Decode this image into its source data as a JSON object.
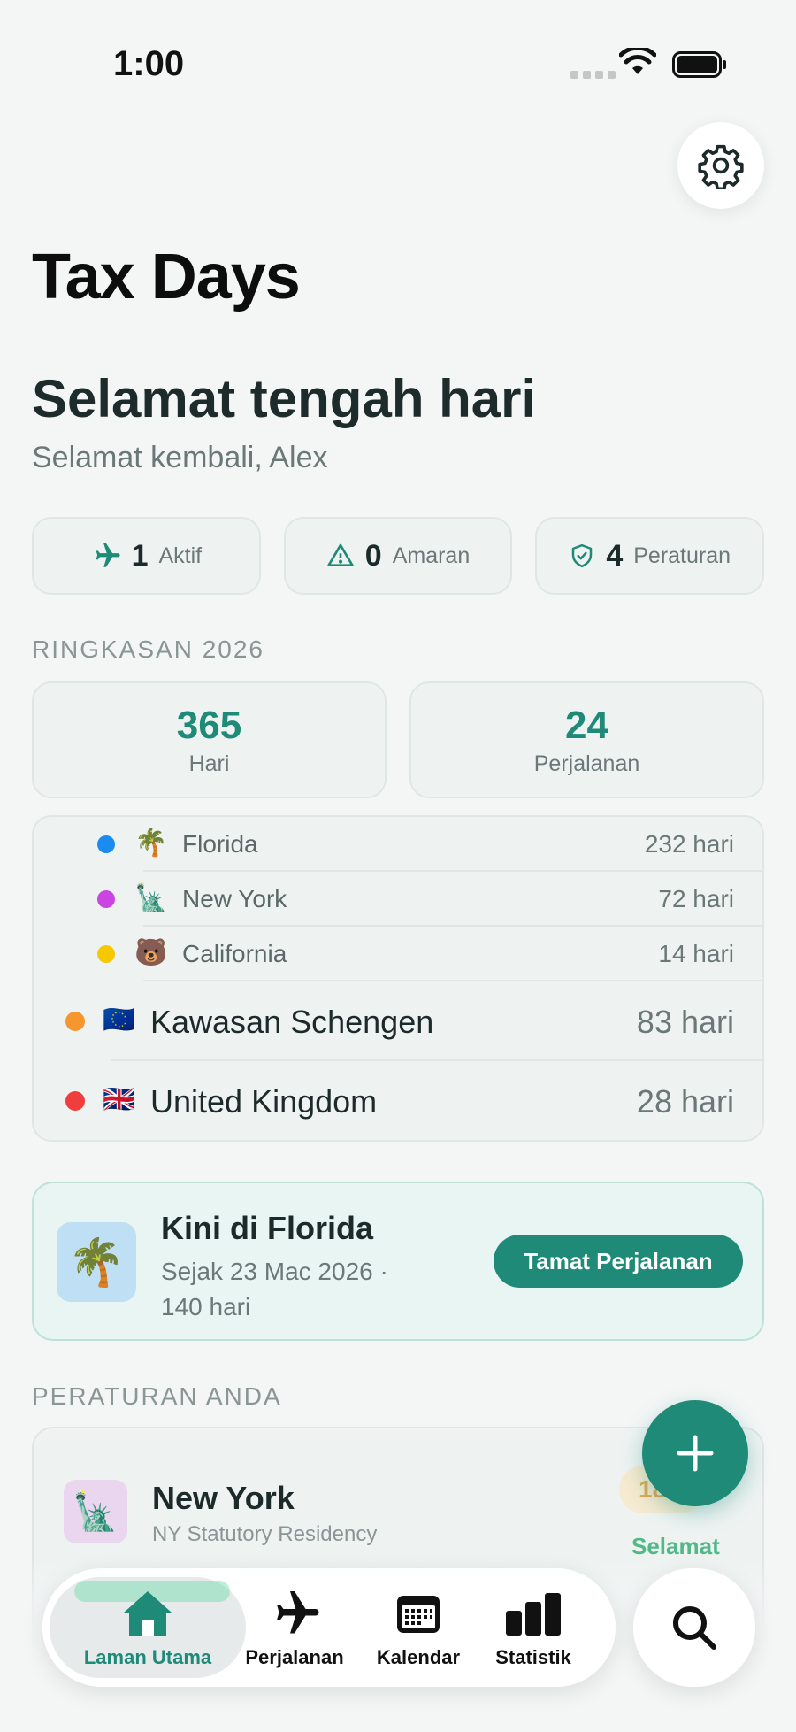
{
  "status": {
    "time": "1:00"
  },
  "header": {
    "title": "Tax Days",
    "greeting": "Selamat tengah hari",
    "welcome": "Selamat kembali, Alex"
  },
  "chips": [
    {
      "value": "1",
      "label": "Aktif",
      "icon": "airplane-icon"
    },
    {
      "value": "0",
      "label": "Amaran",
      "icon": "warning-icon"
    },
    {
      "value": "4",
      "label": "Peraturan",
      "icon": "shield-check-icon"
    }
  ],
  "summary": {
    "heading": "RINGKASAN 2026",
    "days": {
      "value": "365",
      "label": "Hari"
    },
    "trips": {
      "value": "24",
      "label": "Perjalanan"
    }
  },
  "regions": [
    {
      "flag": "🌴",
      "name": "Florida",
      "days": "232 hari",
      "color": "#1a8cf0",
      "level": "sub"
    },
    {
      "flag": "🗽",
      "name": "New York",
      "days": "72 hari",
      "color": "#c944e0",
      "level": "sub"
    },
    {
      "flag": "🐻",
      "name": "California",
      "days": "14 hari",
      "color": "#f5c800",
      "level": "sub"
    },
    {
      "flag": "🇪🇺",
      "name": "Kawasan Schengen",
      "days": "83 hari",
      "color": "#f5962e",
      "level": "main"
    },
    {
      "flag": "🇬🇧",
      "name": "United Kingdom",
      "days": "28 hari",
      "color": "#f03e3e",
      "level": "main"
    }
  ],
  "current": {
    "icon": "🌴",
    "title": "Kini di Florida",
    "subtitle": "Sejak 23 Mac 2026 · 140 hari",
    "button": "Tamat Perjalanan"
  },
  "rules": {
    "heading": "PERATURAN ANDA",
    "item": {
      "icon": "🗽",
      "title": "New York",
      "subtitle": "NY Statutory Residency",
      "badge": "18",
      "status": "Selamat"
    }
  },
  "tabs": [
    {
      "label": "Laman Utama",
      "icon": "home-icon",
      "active": true
    },
    {
      "label": "Perjalanan",
      "icon": "airplane-icon",
      "active": false
    },
    {
      "label": "Kalendar",
      "icon": "calendar-icon",
      "active": false
    },
    {
      "label": "Statistik",
      "icon": "bar-chart-icon",
      "active": false
    }
  ],
  "colors": {
    "accent": "#1f8a78",
    "safe": "#52b888",
    "badge": "#e0a850"
  }
}
